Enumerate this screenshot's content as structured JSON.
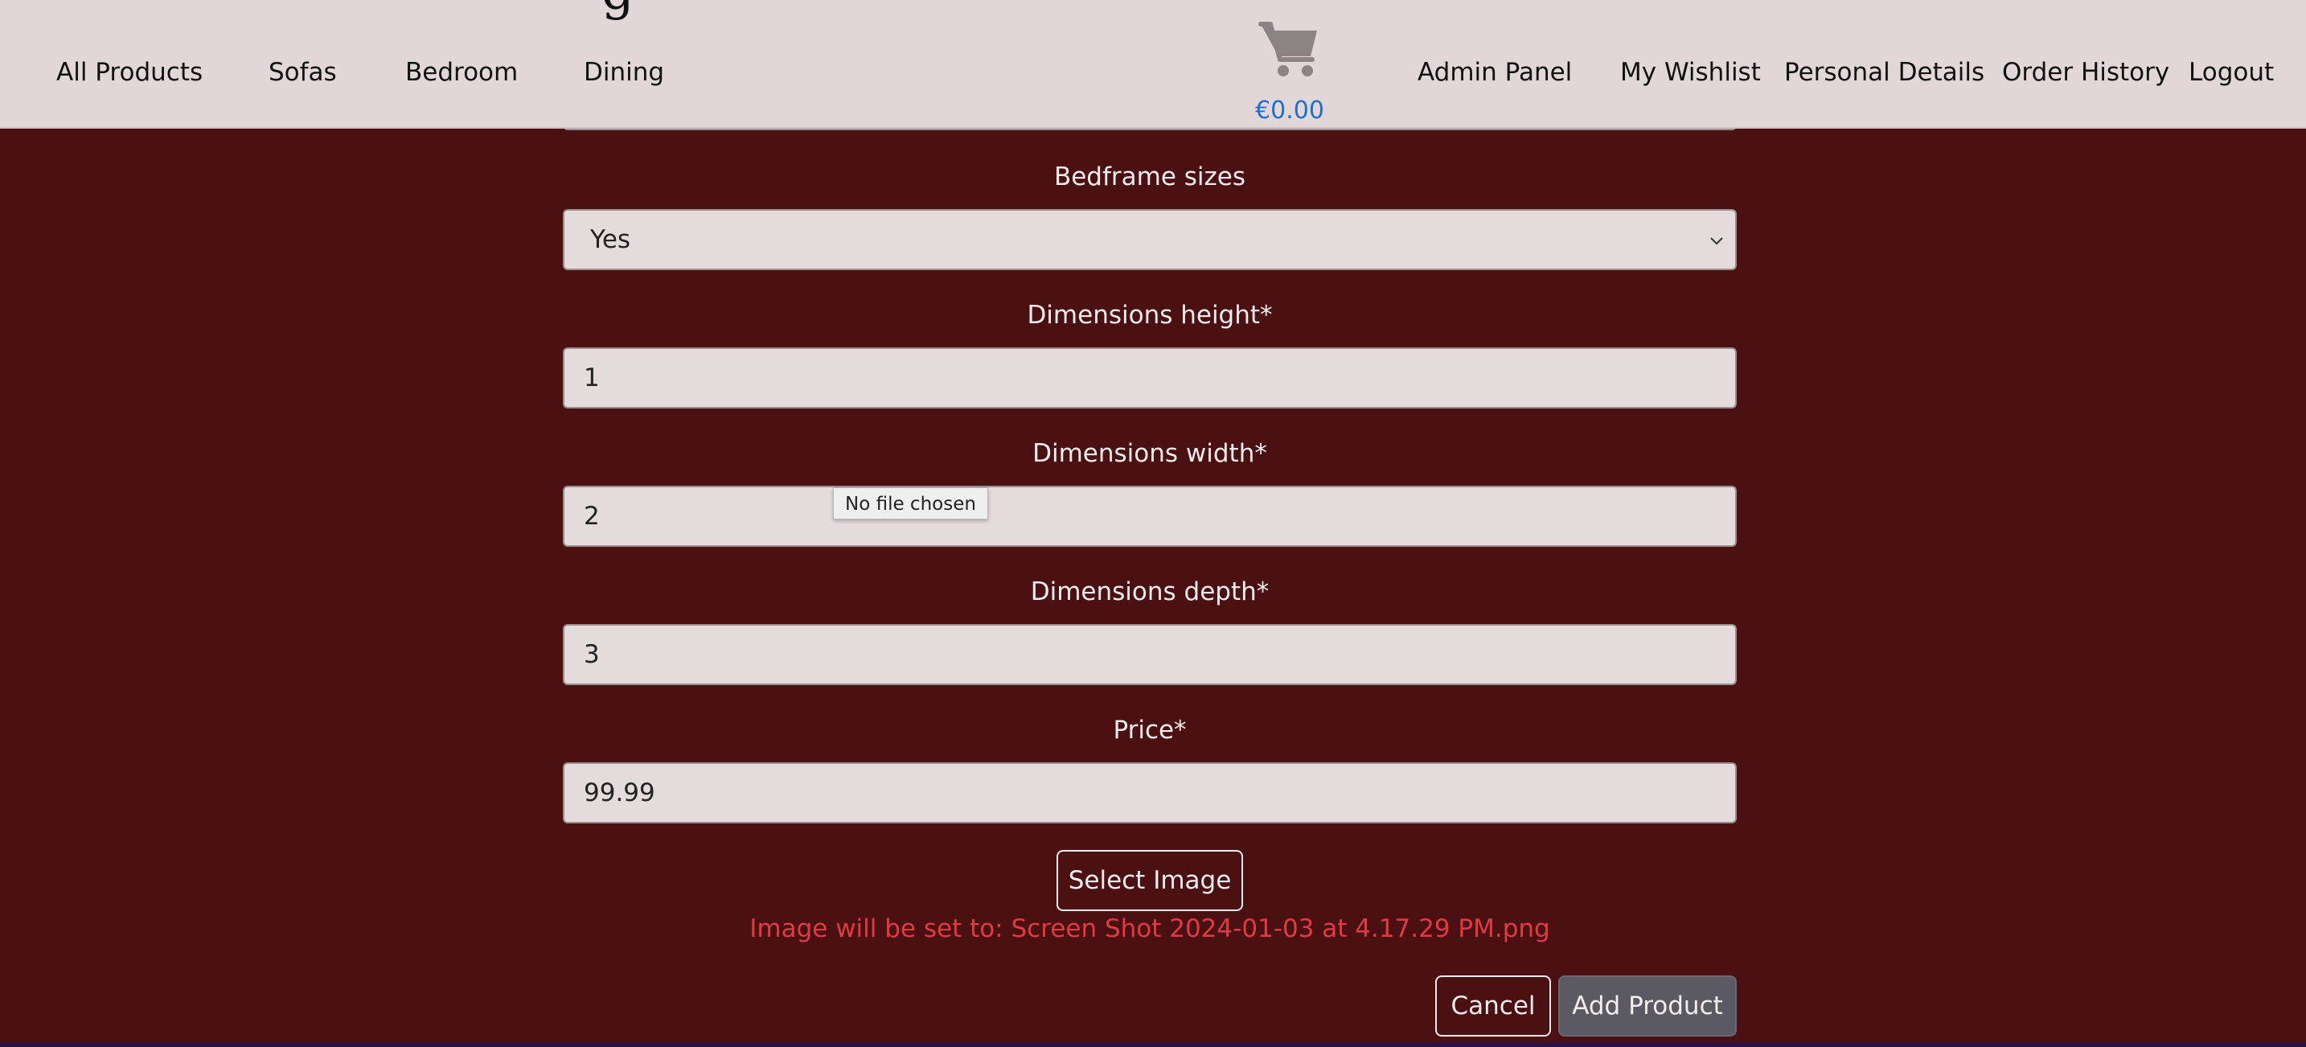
{
  "nav": {
    "left_links": [
      "All Products",
      "Sofas",
      "Bedroom",
      "Dining"
    ],
    "right_links": [
      "Admin Panel",
      "My Wishlist",
      "Personal Details",
      "Order History",
      "Logout"
    ],
    "cart_icon": "shopping-cart-icon",
    "cart_total": "€0.00"
  },
  "form": {
    "bedframe": {
      "label": "Bedframe sizes",
      "value": "Yes"
    },
    "height": {
      "label": "Dimensions height*",
      "value": "1"
    },
    "width": {
      "label": "Dimensions width*",
      "value": "2"
    },
    "depth": {
      "label": "Dimensions depth*",
      "value": "3"
    },
    "price": {
      "label": "Price*",
      "value": "99.99"
    },
    "file_tooltip": "No file chosen",
    "select_image_label": "Select Image",
    "image_note": "Image will be set to: Screen Shot 2024-01-03 at 4.17.29 PM.png",
    "cancel_label": "Cancel",
    "add_label": "Add Product"
  },
  "colors": {
    "background": "#4b1112",
    "navbar": "#e2d7d7",
    "accent_blue": "#1e6fd0",
    "error_red": "#e03a45",
    "button_gray": "#5b5a63"
  }
}
